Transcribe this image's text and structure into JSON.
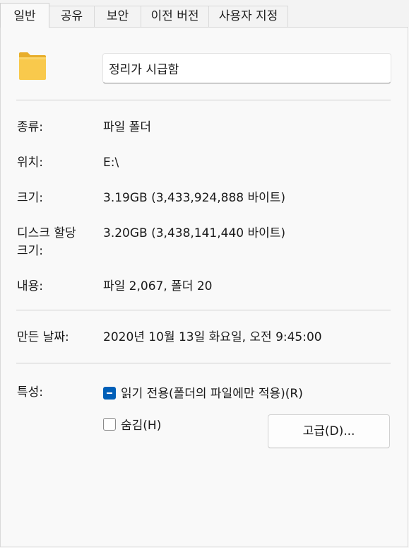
{
  "tabs": [
    {
      "label": "일반",
      "active": true
    },
    {
      "label": "공유",
      "active": false
    },
    {
      "label": "보안",
      "active": false
    },
    {
      "label": "이전 버전",
      "active": false
    },
    {
      "label": "사용자 지정",
      "active": false
    }
  ],
  "folder": {
    "icon": "folder-icon",
    "name": "정리가 시급함"
  },
  "properties": {
    "type_label": "종류:",
    "type_value": "파일 폴더",
    "location_label": "위치:",
    "location_value": "E:\\",
    "size_label": "크기:",
    "size_value": "3.19GB (3,433,924,888 바이트)",
    "disk_size_label": "디스크 할당 크기:",
    "disk_size_value": "3.20GB (3,438,141,440 바이트)",
    "contents_label": "내용:",
    "contents_value": "파일 2,067, 폴더 20",
    "created_label": "만든 날짜:",
    "created_value": "2020년 10월 13일 화요일, 오전 9:45:00"
  },
  "attributes": {
    "label": "특성:",
    "readonly_label": "읽기 전용(폴더의 파일에만 적용)(R)",
    "readonly_state": "indeterminate",
    "hidden_label": "숨김(H)",
    "hidden_state": "unchecked",
    "advanced_button": "고급(D)..."
  },
  "colors": {
    "accent": "#005fb8",
    "folder": "#f8c74a"
  }
}
